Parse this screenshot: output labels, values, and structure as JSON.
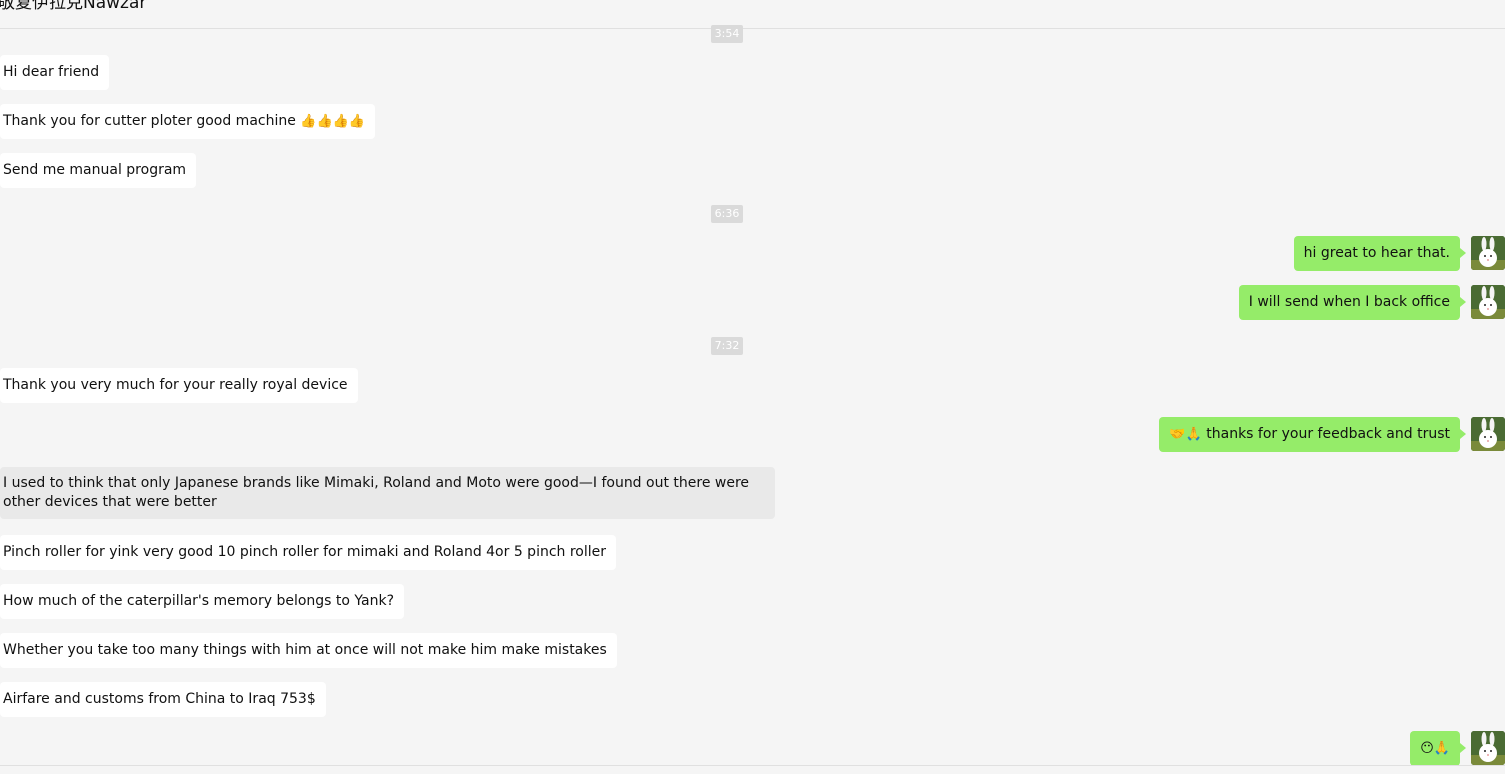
{
  "window": {
    "title": "敬复伊拉克Nawzar"
  },
  "timestamps": [
    "3:54",
    "6:36",
    "7:32"
  ],
  "messages": {
    "m1": "Hi dear friend",
    "m2_text": "Thank you for cutter ploter good machine",
    "m2_emoji": "👍👍👍👍",
    "m3": "Send me manual program",
    "m4": "hi great to hear that.",
    "m5": "I will send when I back office",
    "m6": "Thank you very much for your really royal device",
    "m7_emoji": "🤝🙏",
    "m7_text": "thanks for your feedback and trust",
    "m8": "I used to think that only Japanese brands like Mimaki, Roland and Moto were good—I found out there were other devices that were better",
    "m9": "Pinch roller for yink very good 10 pinch roller for mimaki and Roland 4or 5 pinch roller",
    "m10": "How much of the caterpillar's memory belongs to Yank?",
    "m11": "Whether you take too many things with him at once will not make him make mistakes",
    "m12": "Airfare and customs from China to Iraq 753$",
    "m13_emoji": "😶🙏"
  },
  "icons": {
    "avatar": "white-rabbit-avatar"
  },
  "colors": {
    "background": "#f5f5f5",
    "incoming_bubble": "#ffffff",
    "outgoing_bubble": "#95ec69",
    "selected_bubble": "#e9e9e9",
    "timestamp_bg": "#dadada"
  }
}
